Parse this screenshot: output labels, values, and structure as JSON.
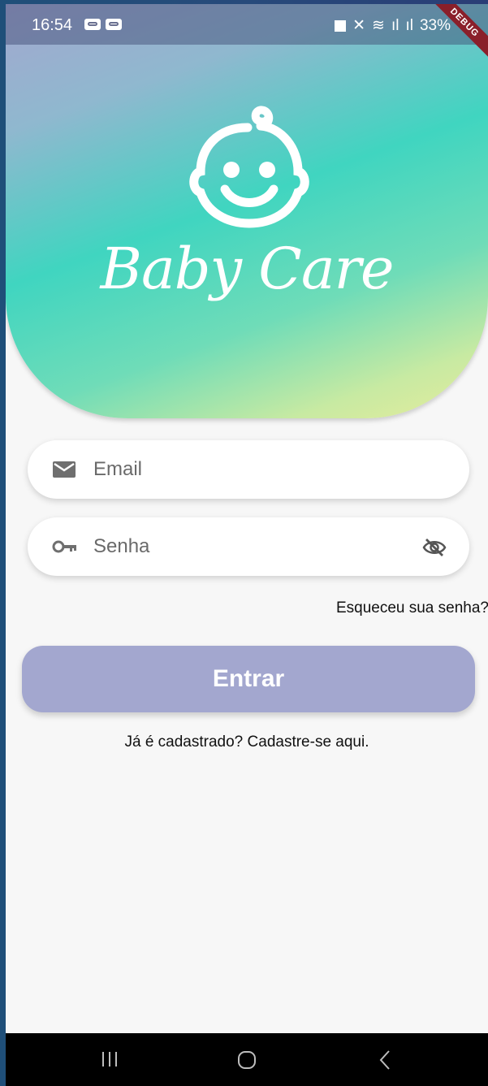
{
  "status_bar": {
    "time": "16:54",
    "battery": "33%",
    "debug_label": "DEBUG"
  },
  "brand": {
    "name": "Baby Care"
  },
  "form": {
    "email": {
      "placeholder": "Email"
    },
    "password": {
      "placeholder": "Senha"
    },
    "forgot_link": "Esqueceu sua senha?",
    "submit_label": "Entrar",
    "signup_text": "Já é cadastrado? Cadastre-se aqui."
  },
  "colors": {
    "accent": "#a3a7cf",
    "teal": "#40d5c0"
  },
  "icons": [
    "email-icon",
    "key-icon",
    "visibility-off-icon",
    "baby-face-icon",
    "recent-apps-icon",
    "home-icon",
    "back-icon"
  ]
}
